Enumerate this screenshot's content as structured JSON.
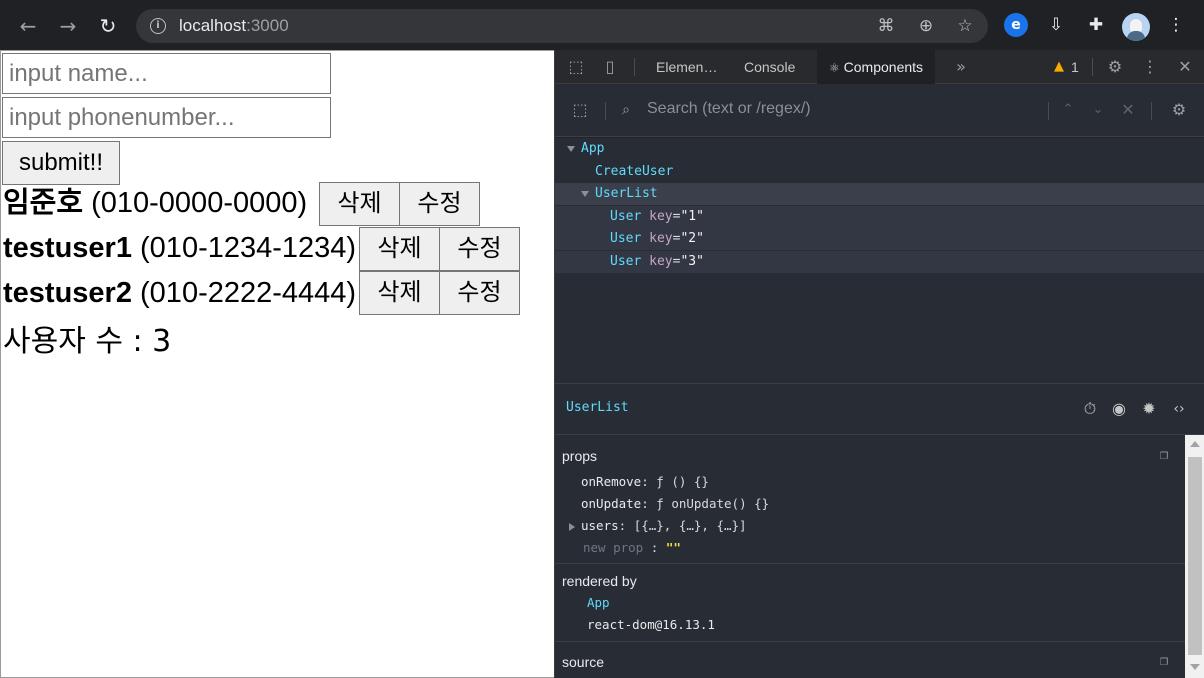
{
  "browser": {
    "url_host": "localhost",
    "url_port": ":3000"
  },
  "form": {
    "name_placeholder": "input name...",
    "phone_placeholder": "input phonenumber...",
    "submit_label": "submit!!"
  },
  "users": [
    {
      "name": "임준호",
      "phone": " (010-0000-0000)",
      "delete_label": "삭제",
      "edit_label": "수정"
    },
    {
      "name": "testuser1",
      "phone": " (010-1234-1234)",
      "delete_label": "삭제",
      "edit_label": "수정"
    },
    {
      "name": "testuser2",
      "phone": " (010-2222-4444)",
      "delete_label": "삭제",
      "edit_label": "수정"
    }
  ],
  "user_count_text": "사용자 수 : 3",
  "devtools": {
    "tabs": [
      "Elemen…",
      "Console",
      "Components"
    ],
    "warning_count": "1",
    "search_placeholder": "Search (text or /regex/)",
    "tree": {
      "app": "App",
      "create_user": "CreateUser",
      "user_list": "UserList",
      "user": "User",
      "key_attr": "key",
      "keys": [
        "\"1\"",
        "\"2\"",
        "\"3\""
      ]
    },
    "selected": "UserList",
    "props_title": "props",
    "props": {
      "on_remove_key": "onRemove",
      "on_remove_val": "ƒ () {}",
      "on_update_key": "onUpdate",
      "on_update_val": "ƒ onUpdate() {}",
      "users_key": "users",
      "users_val": "[{…}, {…}, {…}]",
      "new_prop_key": "new prop",
      "new_prop_val": "\"\""
    },
    "rendered_by_title": "rendered by",
    "rendered_by": [
      "App",
      "react-dom@16.13.1"
    ],
    "source_title": "source"
  }
}
